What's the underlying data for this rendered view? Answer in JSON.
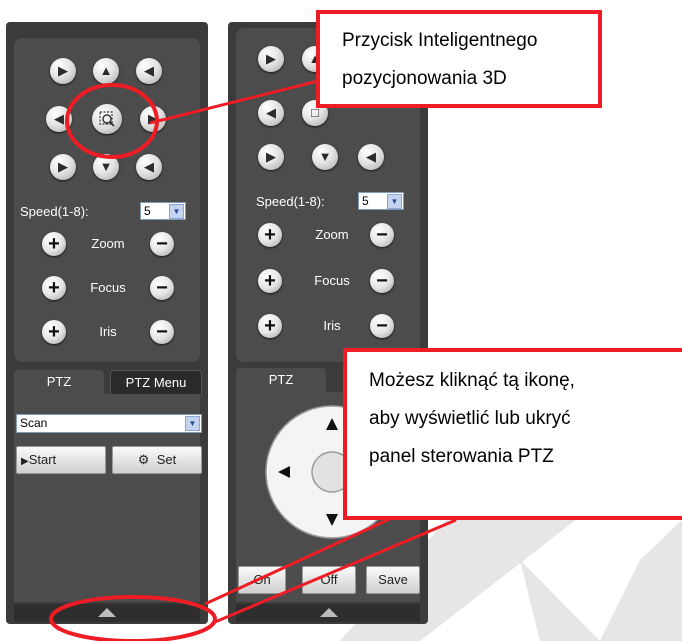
{
  "left_panel": {
    "speed_label": "Speed(1-8):",
    "speed_value": "5",
    "zoom_label": "Zoom",
    "focus_label": "Focus",
    "iris_label": "Iris",
    "tabs": [
      "PTZ",
      "PTZ Menu"
    ],
    "mode_value": "Scan",
    "start_label": "Start",
    "set_label": "Set"
  },
  "right_panel": {
    "speed_label": "Speed(1-8):",
    "speed_value": "5",
    "zoom_label": "Zoom",
    "focus_label": "Focus",
    "iris_label": "Iris",
    "tab_label": "PTZ",
    "on_label": "On",
    "off_label": "Off",
    "save_label": "Save"
  },
  "callouts": {
    "top": [
      "Przycisk Inteligentnego",
      "pozycjonowania 3D"
    ],
    "bottom": [
      "Możesz kliknąć tą ikonę,",
      "aby wyświetlić lub ukryć",
      "panel sterowania PTZ"
    ]
  },
  "colors": {
    "panel": "#3b3b3b",
    "callout_border": "#ee1c25",
    "watermark": "#dcdcdc"
  }
}
